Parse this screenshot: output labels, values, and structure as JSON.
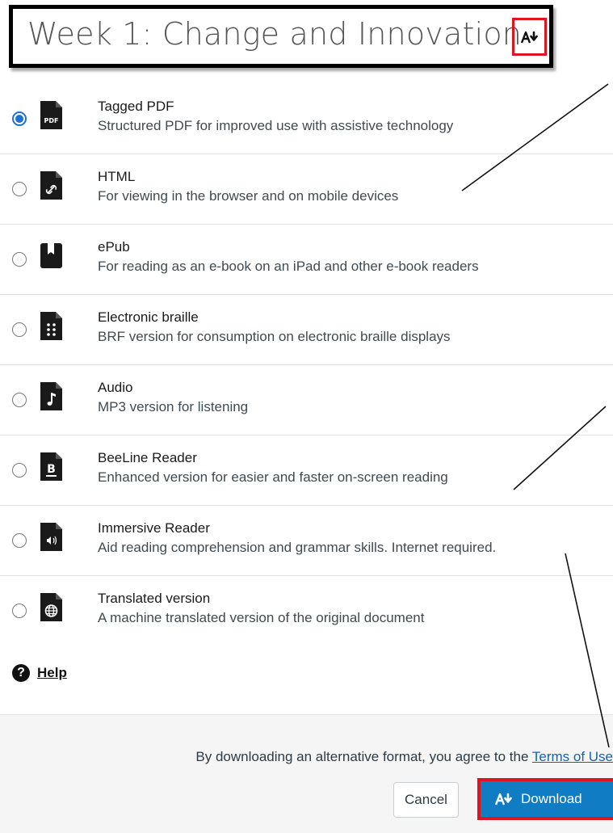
{
  "header": {
    "title": "Week 1: Change and Innovation",
    "icon": "alt-format-download-icon"
  },
  "options": [
    {
      "title": "Tagged PDF",
      "description": "Structured PDF for improved use with assistive technology",
      "icon": "pdf-file-icon",
      "selected": true
    },
    {
      "title": "HTML",
      "description": "For viewing in the browser and on mobile devices",
      "icon": "html-link-file-icon",
      "selected": false
    },
    {
      "title": "ePub",
      "description": "For reading as an e-book on an iPad and other e-book readers",
      "icon": "epub-book-icon",
      "selected": false
    },
    {
      "title": "Electronic braille",
      "description": "BRF version for consumption on electronic braille displays",
      "icon": "braille-file-icon",
      "selected": false
    },
    {
      "title": "Audio",
      "description": "MP3 version for listening",
      "icon": "audio-file-icon",
      "selected": false
    },
    {
      "title": "BeeLine Reader",
      "description": "Enhanced version for easier and faster on-screen reading",
      "icon": "beeline-file-icon",
      "selected": false
    },
    {
      "title": "Immersive Reader",
      "description": "Aid reading comprehension and grammar skills. Internet required.",
      "icon": "immersive-reader-file-icon",
      "selected": false
    },
    {
      "title": "Translated version",
      "description": "A machine translated version of the original document",
      "icon": "globe-file-icon",
      "selected": false
    }
  ],
  "help": {
    "label": "Help",
    "icon": "question-circle-icon"
  },
  "footer": {
    "agreement_text": "By downloading an alternative format, you agree to the ",
    "terms_link": "Terms of Use",
    "cancel_label": "Cancel",
    "download_label": "Download"
  },
  "colors": {
    "accent": "#0f7cc4",
    "radio_selected": "#1e70d6",
    "highlight_border": "#e0141e"
  }
}
